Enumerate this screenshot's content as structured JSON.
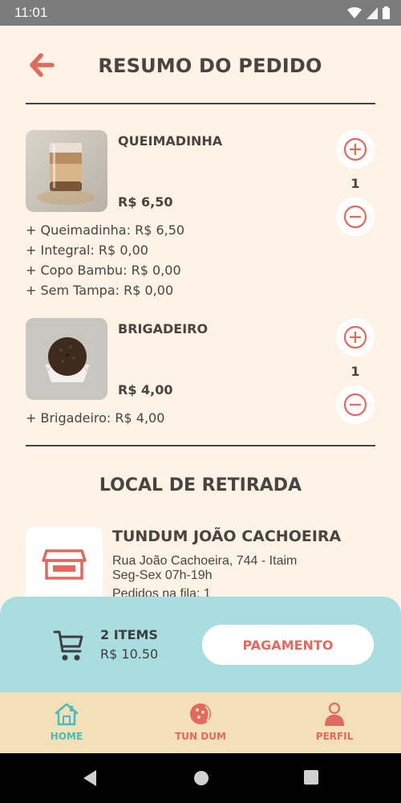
{
  "status_bar": {
    "time": "11:01"
  },
  "header": {
    "title": "RESUMO DO PEDIDO"
  },
  "order_items": [
    {
      "name": "QUEIMADINHA",
      "price": "R$ 6,50",
      "quantity": "1",
      "options": [
        "+ Queimadinha: R$ 6,50",
        "+ Integral: R$ 0,00",
        "+ Copo Bambu: R$ 0,00",
        "+ Sem Tampa: R$ 0,00"
      ]
    },
    {
      "name": "BRIGADEIRO",
      "price": "R$ 4,00",
      "quantity": "1",
      "options": [
        "+ Brigadeiro: R$ 4,00"
      ]
    }
  ],
  "pickup": {
    "section_title": "LOCAL DE RETIRADA",
    "store_name": "TUNDUM JOÃO CACHOEIRA",
    "address": "Rua João Cachoeira, 744 - Itaim",
    "hours": "Seg-Sex 07h-19h",
    "queue": "Pedidos na fila: 1"
  },
  "cart": {
    "items_label": "2 ITEMS",
    "total": "R$ 10.50",
    "pay_label": "PAGAMENTO"
  },
  "tabs": [
    {
      "label": "HOME",
      "color": "#4bb9bd",
      "icon": "home-icon"
    },
    {
      "label": "TUN DUM",
      "color": "#e2695e",
      "icon": "tundum-icon"
    },
    {
      "label": "PERFIL",
      "color": "#e2695e",
      "icon": "profile-icon"
    }
  ],
  "colors": {
    "accent": "#e2695e",
    "teal": "#4bb9bd",
    "background": "#fdf3e6",
    "cart_bar": "#a9dddf",
    "tab_bar": "#f3dfba"
  }
}
